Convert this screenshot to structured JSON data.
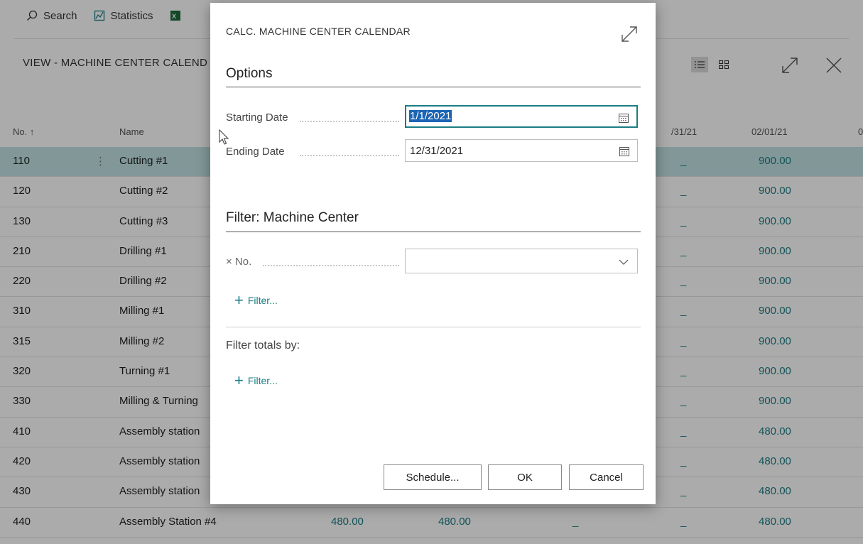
{
  "toolbar": {
    "search": "Search",
    "statistics": "Statistics"
  },
  "page": {
    "title": "VIEW - MACHINE CENTER CALEND"
  },
  "grid": {
    "headers": {
      "no": "No. ↑",
      "name": "Name",
      "col_a": "/31/21",
      "col_b": "02/01/21",
      "col_c": "0"
    },
    "rows": [
      {
        "no": "110",
        "name": "Cutting #1",
        "a": "",
        "b": "",
        "d1": "",
        "d2": "_",
        "val": "900.00"
      },
      {
        "no": "120",
        "name": "Cutting #2",
        "a": "",
        "b": "",
        "d1": "",
        "d2": "_",
        "val": "900.00"
      },
      {
        "no": "130",
        "name": "Cutting #3",
        "a": "",
        "b": "",
        "d1": "",
        "d2": "_",
        "val": "900.00"
      },
      {
        "no": "210",
        "name": "Drilling #1",
        "a": "",
        "b": "",
        "d1": "",
        "d2": "_",
        "val": "900.00"
      },
      {
        "no": "220",
        "name": "Drilling #2",
        "a": "",
        "b": "",
        "d1": "",
        "d2": "_",
        "val": "900.00"
      },
      {
        "no": "310",
        "name": "Milling #1",
        "a": "",
        "b": "",
        "d1": "",
        "d2": "_",
        "val": "900.00"
      },
      {
        "no": "315",
        "name": "Milling #2",
        "a": "",
        "b": "",
        "d1": "",
        "d2": "_",
        "val": "900.00"
      },
      {
        "no": "320",
        "name": "Turning #1",
        "a": "",
        "b": "",
        "d1": "",
        "d2": "_",
        "val": "900.00"
      },
      {
        "no": "330",
        "name": "Milling & Turning",
        "a": "",
        "b": "",
        "d1": "",
        "d2": "_",
        "val": "900.00"
      },
      {
        "no": "410",
        "name": "Assembly station",
        "a": "",
        "b": "",
        "d1": "",
        "d2": "_",
        "val": "480.00"
      },
      {
        "no": "420",
        "name": "Assembly station",
        "a": "",
        "b": "",
        "d1": "",
        "d2": "_",
        "val": "480.00"
      },
      {
        "no": "430",
        "name": "Assembly station",
        "a": "",
        "b": "",
        "d1": "",
        "d2": "_",
        "val": "480.00"
      },
      {
        "no": "440",
        "name": "Assembly Station #4",
        "a": "480.00",
        "b": "480.00",
        "d1": "_",
        "d2": "_",
        "val": "480.00"
      }
    ]
  },
  "dialog": {
    "title": "CALC. MACHINE CENTER CALENDAR",
    "options_heading": "Options",
    "starting_date_label": "Starting Date",
    "starting_date_value": "1/1/2021",
    "ending_date_label": "Ending Date",
    "ending_date_value": "12/31/2021",
    "filter_heading": "Filter: Machine Center",
    "no_label": "× No.",
    "add_filter_1": "Filter...",
    "filter_totals_label": "Filter totals by:",
    "add_filter_2": "Filter...",
    "buttons": {
      "schedule": "Schedule...",
      "ok": "OK",
      "cancel": "Cancel"
    }
  },
  "colors": {
    "accent": "#1b7d84",
    "selected_row": "#c1e2e3",
    "selection": "#1b64b4"
  }
}
